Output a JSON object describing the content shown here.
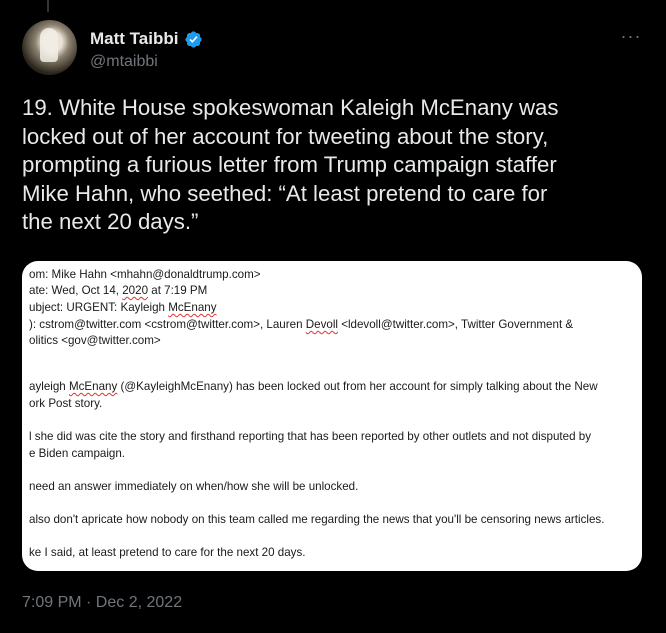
{
  "author": {
    "name": "Matt Taibbi",
    "handle": "@mtaibbi"
  },
  "more_label": "···",
  "tweet": {
    "text": "19. White House spokeswoman Kaleigh McEnany was\nlocked out of her account for tweeting about the story,\nprompting a furious letter from Trump campaign staffer\nMike Hahn, who seethed: “At least pretend to care for\nthe next 20 days.”"
  },
  "email": {
    "from": "om: Mike Hahn <mhahn@donaldtrump.com>",
    "date_prefix": "ate: Wed, Oct 14, ",
    "date_year": "2020",
    "date_suffix": " at 7:19 PM",
    "subject_prefix": "ubject: URGENT: Kayleigh ",
    "subject_name": "McEnany",
    "to_line1_prefix": "): cstrom@twitter.com <cstrom@twitter.com>, Lauren ",
    "to_line1_name": "Devoll",
    "to_line1_suffix": " <ldevoll@twitter.com>, Twitter Government &",
    "to_line2": "olitics <gov@twitter.com>",
    "p1_prefix": "ayleigh ",
    "p1_name": "McEnany",
    "p1_suffix": " (@KayleighMcEnany) has been locked out from her account for simply talking about the New",
    "p1_line2": "ork Post story.",
    "p2_line1": "l she did was cite the story and firsthand reporting that has been reported by other outlets and not disputed by",
    "p2_line2": "e Biden campaign.",
    "p3": "need an answer immediately on when/how she will be unlocked.",
    "p4": "also don't apricate how nobody on this team called me regarding the news that you'll be censoring news articles.",
    "p5": "ke I said, at least pretend to care for the next 20 days."
  },
  "timestamp": "7:09 PM · Dec 2, 2022",
  "colors": {
    "verified": "#1d9bf0",
    "muted": "#71767b",
    "text": "#e7e9ea"
  }
}
